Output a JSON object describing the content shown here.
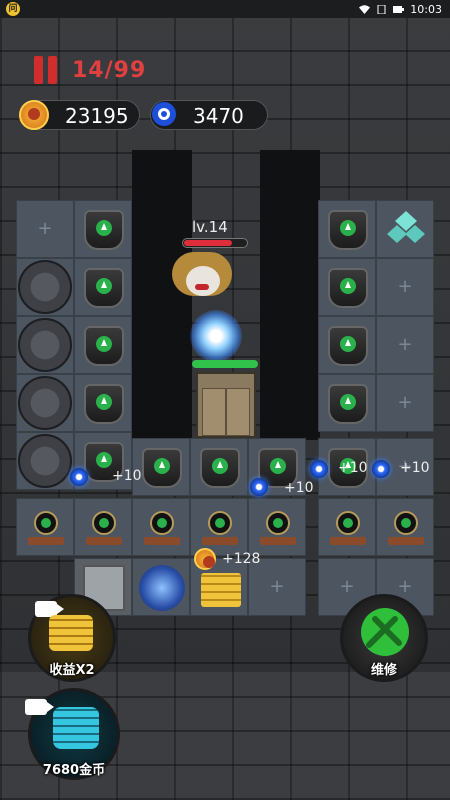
{
  "statusbar": {
    "time": "10:03",
    "app_icon": "问"
  },
  "hud": {
    "wave": "14/99",
    "coins": "23195",
    "gems": "3470"
  },
  "enemy": {
    "level": "lv.14",
    "hp_fraction": 0.78
  },
  "floaters": {
    "plus10_a": "+10",
    "plus10_b": "+10",
    "plus10_c": "+10",
    "plus10_d": "+10",
    "plus128": "+128"
  },
  "buttons": {
    "income_x2": "收益X2",
    "repair": "维修",
    "coins_reward": "7680金币"
  },
  "colors": {
    "wave": "#e04040",
    "repair": "#2fbf3a",
    "income": "#e8b82e",
    "coins_reward": "#2a9db5"
  }
}
